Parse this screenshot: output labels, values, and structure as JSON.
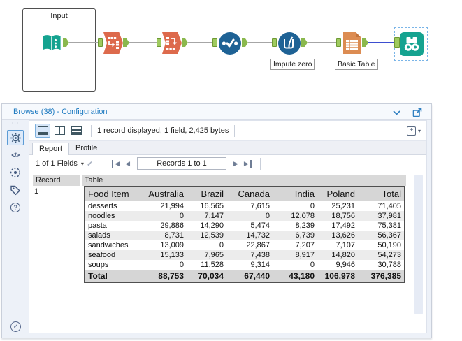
{
  "canvas": {
    "input_container_label": "Input",
    "tool_labels": {
      "imputation": "Impute zero",
      "basic_table": "Basic Table"
    }
  },
  "panel": {
    "title": "Browse (38) - Configuration",
    "toolbar": {
      "status": "1 record displayed, 1 field, 2,425 bytes"
    },
    "tabs": {
      "report": "Report",
      "profile": "Profile"
    },
    "nav": {
      "fields": "1 of 1 Fields",
      "records": "Records 1 to 1"
    },
    "grid": {
      "record_header": "Record",
      "table_header": "Table",
      "record_value": "1"
    }
  },
  "report_table": {
    "columns": [
      "Food Item",
      "Australia",
      "Brazil",
      "Canada",
      "India",
      "Poland",
      "Total"
    ],
    "rows": [
      [
        "desserts",
        "21,994",
        "16,565",
        "7,615",
        "0",
        "25,231",
        "71,405"
      ],
      [
        "noodles",
        "0",
        "7,147",
        "0",
        "12,078",
        "18,756",
        "37,981"
      ],
      [
        "pasta",
        "29,886",
        "14,290",
        "5,474",
        "8,239",
        "17,492",
        "75,381"
      ],
      [
        "salads",
        "8,731",
        "12,539",
        "14,732",
        "6,739",
        "13,626",
        "56,367"
      ],
      [
        "sandwiches",
        "13,009",
        "0",
        "22,867",
        "7,207",
        "7,107",
        "50,190"
      ],
      [
        "seafood",
        "15,133",
        "7,965",
        "7,438",
        "8,917",
        "14,820",
        "54,273"
      ],
      [
        "soups",
        "0",
        "11,528",
        "9,314",
        "0",
        "9,946",
        "30,788"
      ]
    ],
    "total_row": [
      "Total",
      "88,753",
      "70,034",
      "67,440",
      "43,180",
      "106,978",
      "376,385"
    ]
  },
  "icons": {
    "dots": "⋯",
    "caret_down": "▾",
    "check_small": "✔",
    "nav_prev": "◀",
    "nav_next": "▶",
    "code": "</>",
    "question": "?",
    "plus": "+",
    "check_badge": "✓"
  },
  "colors": {
    "accent_blue": "#1b79c0",
    "tool_orange": "#dd6a4c",
    "doc_orange": "#dc8c52",
    "tool_teal": "#15a390",
    "tool_blue": "#1e6295",
    "anchor_green": "#9fca5f",
    "selected_connection": "#3d4ed0",
    "table_header_bg": "#d6d6d6",
    "alt_row_bg": "#ececec"
  }
}
